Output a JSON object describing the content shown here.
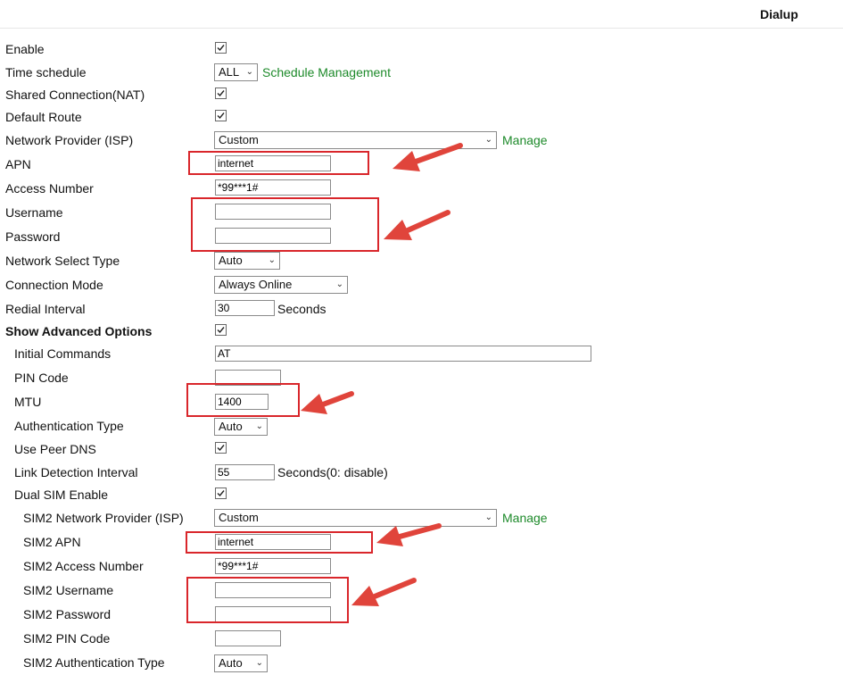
{
  "header": {
    "title": "Dialup"
  },
  "labels": {
    "enable": "Enable",
    "time_schedule": "Time schedule",
    "shared_connection": "Shared Connection(NAT)",
    "default_route": "Default Route",
    "network_provider": "Network Provider (ISP)",
    "apn": "APN",
    "access_number": "Access Number",
    "username": "Username",
    "password": "Password",
    "network_select_type": "Network Select Type",
    "connection_mode": "Connection Mode",
    "redial_interval": "Redial Interval",
    "show_advanced": "Show Advanced Options",
    "initial_commands": "Initial Commands",
    "pin_code": "PIN Code",
    "mtu": "MTU",
    "authentication_type": "Authentication Type",
    "use_peer_dns": "Use Peer DNS",
    "link_detection_interval": "Link Detection Interval",
    "dual_sim_enable": "Dual SIM Enable",
    "sim2_network_provider": "SIM2 Network Provider (ISP)",
    "sim2_apn": "SIM2 APN",
    "sim2_access_number": "SIM2 Access Number",
    "sim2_username": "SIM2 Username",
    "sim2_password": "SIM2 Password",
    "sim2_pin_code": "SIM2 PIN Code",
    "sim2_authentication_type": "SIM2 Authentication Type"
  },
  "values": {
    "time_schedule": "ALL",
    "network_provider": "Custom",
    "apn": "internet",
    "access_number": "*99***1#",
    "username": "",
    "password": "",
    "network_select_type": "Auto",
    "connection_mode": "Always Online",
    "redial_interval": "30",
    "initial_commands": "AT",
    "pin_code": "",
    "mtu": "1400",
    "authentication_type": "Auto",
    "link_detection_interval": "55",
    "sim2_network_provider": "Custom",
    "sim2_apn": "internet",
    "sim2_access_number": "*99***1#",
    "sim2_username": "",
    "sim2_password": "",
    "sim2_pin_code": "",
    "sim2_authentication_type": "Auto"
  },
  "checkboxes": {
    "enable": true,
    "shared_connection": true,
    "default_route": true,
    "show_advanced": true,
    "use_peer_dns": true,
    "dual_sim_enable": true
  },
  "links": {
    "schedule_management": "Schedule Management",
    "manage": "Manage",
    "sim2_manage": "Manage"
  },
  "units": {
    "redial_interval": "Seconds",
    "link_detection_interval": "Seconds(0: disable)"
  },
  "icons": {
    "dropdown": "chevron-down-icon",
    "checkbox": "checkmark-icon",
    "annotation": "red-arrow-icon"
  },
  "colors": {
    "link": "#1d8a2a",
    "annotation": "#d9262b"
  }
}
